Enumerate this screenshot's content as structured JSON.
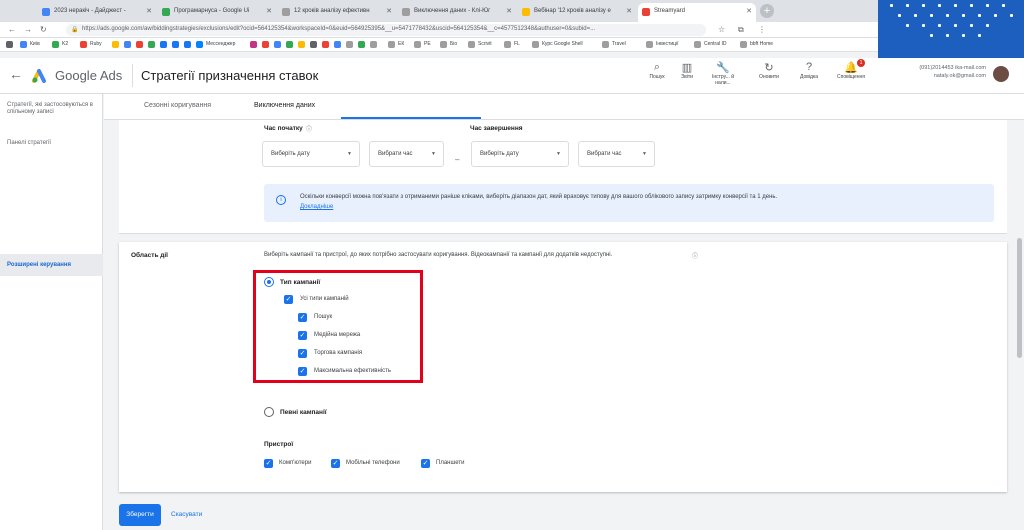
{
  "browser": {
    "tabs": [
      {
        "title": "2023 неракіч - Дайджест -",
        "color": "#4285f4"
      },
      {
        "title": "Програмарнуса - Google Ui",
        "color": "#34a853"
      },
      {
        "title": "12 кроків аналізу ефективн",
        "color": "#9e9e9e"
      },
      {
        "title": "Виключення даних - Клі-Юг",
        "color": "#9e9e9e"
      },
      {
        "title": "Вебінар '12 кроків аналізу е",
        "color": "#fbbc04"
      },
      {
        "title": "Streamyard",
        "color": "#ea4335"
      }
    ],
    "new_tab": "+",
    "url": "https://ads.google.com/aw/biddingstrategies/exclusions/edit?ocid=564125354&workspaceId=0&euid=564925395&__u=5471778432&uscid=564125354&__c=4577512348&authuser=0&subid=..."
  },
  "bookmarks": [
    "Київ",
    "K2",
    "Ruby",
    "Мессенджер",
    "ЕК",
    "РЕ",
    "Біо",
    "Scrivit",
    "FL",
    "Курс Google Shell",
    "Travel",
    "Інвестиції",
    "Central ID",
    "bbft Home"
  ],
  "header": {
    "product": "Google Ads",
    "title": "Стратегії призначення ставок",
    "icons": [
      {
        "icon": "search-icon",
        "label": "Пошук"
      },
      {
        "icon": "chart-icon",
        "label": "Звіти"
      },
      {
        "icon": "wrench-icon",
        "label": "Інстру... й нали..."
      },
      {
        "icon": "refresh-icon",
        "label": "Оновити"
      },
      {
        "icon": "help-icon",
        "label": "Довідка"
      },
      {
        "icon": "bell-icon",
        "label": "Сповіщення"
      }
    ],
    "notifications": "1",
    "account_line1": "(091)2014453 ika-mail.com",
    "account_line2": "nataly.ok@gmail.com"
  },
  "sidebar": {
    "items": [
      "Стратегії, які застосовуються в спільному записі",
      "Панелі стратегії",
      "Розширені керування"
    ]
  },
  "tabs": [
    "Сезонні коригування",
    "Виключення даних"
  ],
  "form": {
    "start_label": "Час початку",
    "end_label": "Час завершення",
    "select_date": "Виберіть дату",
    "select_time": "Вибрати час",
    "dash": "–",
    "info_text": "Оскільки конверсії можна пов'язати з отриманими раніше кліками, виберіть діапазон дат, який враховує типову для вашого облікового запису затримку конверсії та 1 день.",
    "info_link": "Докладніше"
  },
  "scope": {
    "label": "Область дії",
    "description": "Виберіть кампанії та пристрої, до яких потрібно застосувати коригування. Відеокампанії та кампанії для додатків недоступні.",
    "campaign_types_label": "Тип кампанії",
    "all_types": "Усі типи кампаній",
    "types": [
      "Пошук",
      "Медійна мережа",
      "Торгова кампанія",
      "Максимальна ефективність"
    ],
    "specific_campaigns": "Певні кампанії",
    "devices_label": "Пристрої",
    "devices": [
      "Комп'ютери",
      "Мобільні телефони",
      "Планшети"
    ]
  },
  "actions": {
    "save": "Зберегти",
    "cancel": "Скасувати"
  },
  "colors": {
    "accent": "#1a73e8",
    "highlight": "#e3001b"
  }
}
